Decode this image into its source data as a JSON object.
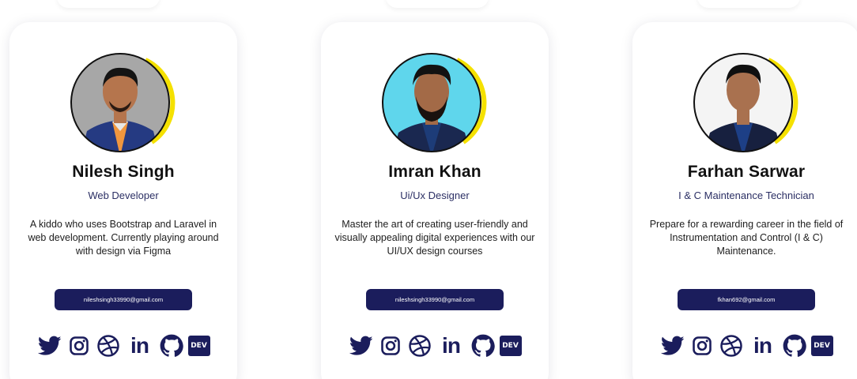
{
  "cards": [
    {
      "name": "Nilesh Singh",
      "role": "Web Developer",
      "bio": "A kiddo who uses Bootstrap and Laravel in web development. Currently playing around with design via Figma",
      "email": "nileshsingh33990@gmail.com",
      "avatar": {
        "bg": "#a7a7a7",
        "skin": "#b5754d",
        "shirt": "#f0963e",
        "suit": "#253a82",
        "ring": "#f5e100"
      }
    },
    {
      "name": "Imran Khan",
      "role": "Ui/Ux Designer",
      "bio": "Master the art of creating user-friendly and visually appealing digital experiences with our UI/UX design courses",
      "email": "nileshsingh33990@gmail.com",
      "avatar": {
        "bg": "#5fd6ec",
        "skin": "#a36a47",
        "shirt": "#1d3c78",
        "suit": "#1a2850",
        "ring": "#f5e100"
      }
    },
    {
      "name": "Farhan Sarwar",
      "role": "I & C Maintenance Technician",
      "bio": "Prepare for a rewarding career in the field of Instrumentation and Control (I & C) Maintenance.",
      "email": "fkhan692@gmail.com",
      "avatar": {
        "bg": "#f4f4f4",
        "skin": "#a9714f",
        "shirt": "#1d3f86",
        "suit": "#17203f",
        "ring": "#f5e100"
      }
    }
  ],
  "socials": [
    "twitter-icon",
    "instagram-icon",
    "dribbble-icon",
    "linkedin-icon",
    "github-icon",
    "dev-icon"
  ],
  "social_text": {
    "linkedin": "in",
    "dev": "DEV"
  },
  "colors": {
    "accent": "#1b1d5c",
    "ring": "#f5e100"
  }
}
